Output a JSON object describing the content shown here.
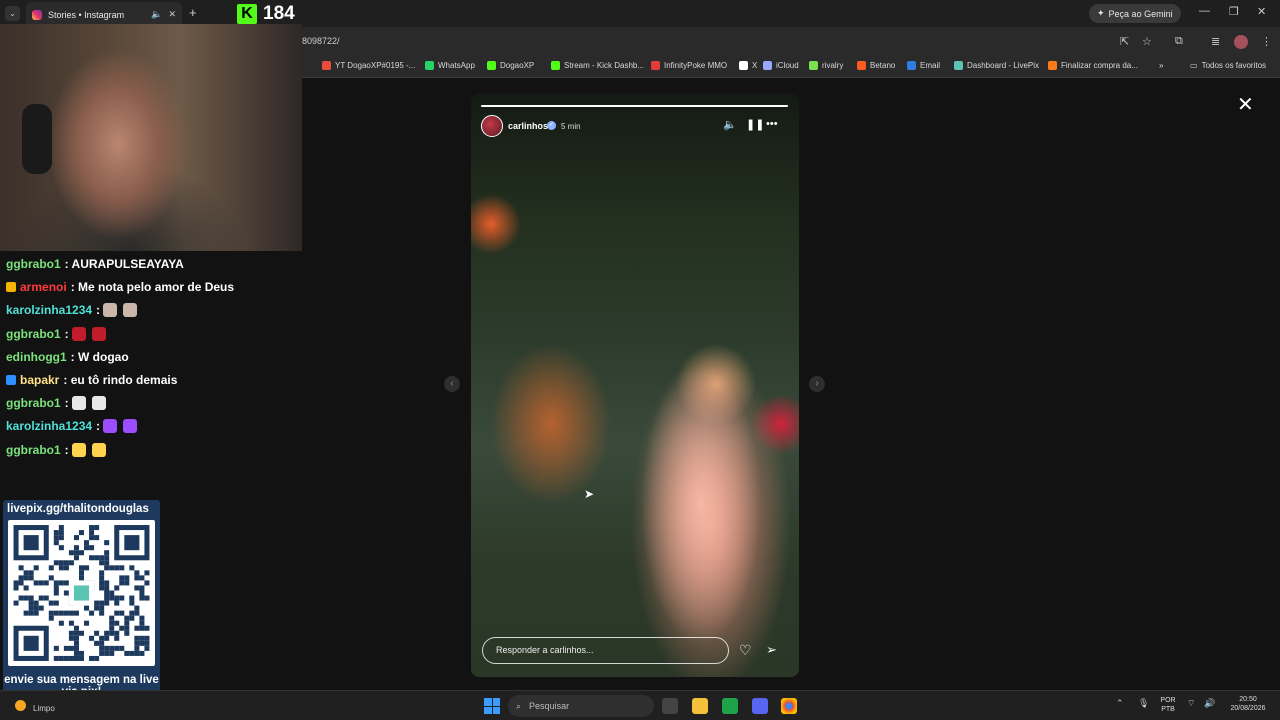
{
  "browser": {
    "tab_title": "Stories • Instagram",
    "gemini_label": "Peça ao Gemini",
    "url": "8098722/",
    "bookmarks": [
      {
        "label": "YT DogaoXP#0195 -...",
        "color": "#e74c3c"
      },
      {
        "label": "WhatsApp",
        "color": "#25d366"
      },
      {
        "label": "DogaoXP",
        "color": "#53fc18"
      },
      {
        "label": "Stream - Kick Dashb...",
        "color": "#53fc18"
      },
      {
        "label": "InfinityPoke MMO",
        "color": "#e23b3b"
      },
      {
        "label": "X",
        "color": "#ffffff"
      },
      {
        "label": "iCloud",
        "color": "#9aa7ff"
      },
      {
        "label": "rivalry",
        "color": "#7be04f"
      },
      {
        "label": "Betano",
        "color": "#ff5a1f"
      },
      {
        "label": "Email",
        "color": "#2f7de1"
      },
      {
        "label": "Dashboard - LivePix",
        "color": "#5bc4b2"
      },
      {
        "label": "Finalizar compra da...",
        "color": "#ff7a1a"
      }
    ],
    "all_bookmarks": "Todos os favoritos"
  },
  "story": {
    "username": "carlinhos",
    "time": "5 min",
    "progress": 1.0,
    "reply_placeholder": "Responder a carlinhos..."
  },
  "stream": {
    "viewer_count": "184",
    "chat": [
      {
        "user": "ggbrabo1",
        "user_color": "#7ce37c",
        "text": ": AURAPULSEAYAYA",
        "badge": null,
        "emotes": []
      },
      {
        "user": "armenoi",
        "user_color": "#ff3b3b",
        "text": ": Me nota pelo amor de Deus",
        "badge": "#f5b400",
        "emotes": []
      },
      {
        "user": "karolzinha1234",
        "user_color": "#4fe0d8",
        "text": ":",
        "badge": null,
        "emotes": [
          "#c9b6a8",
          "#c9b6a8"
        ]
      },
      {
        "user": "ggbrabo1",
        "user_color": "#7ce37c",
        "text": ":",
        "badge": null,
        "emotes": [
          "#c01c2c",
          "#c01c2c"
        ]
      },
      {
        "user": "edinhogg1",
        "user_color": "#7ce37c",
        "text": ": W dogao",
        "badge": null,
        "emotes": []
      },
      {
        "user": "bapakr",
        "user_color": "#ffe08a",
        "text": ": eu tô rindo demais",
        "badge": "#2e8fff",
        "emotes": []
      },
      {
        "user": "ggbrabo1",
        "user_color": "#7ce37c",
        "text": ":",
        "badge": null,
        "emotes": [
          "#e8e8e8",
          "#e8e8e8"
        ]
      },
      {
        "user": "karolzinha1234",
        "user_color": "#4fe0d8",
        "text": ":",
        "badge": null,
        "emotes": [
          "#9b4dff",
          "#9b4dff"
        ]
      },
      {
        "user": "ggbrabo1",
        "user_color": "#7ce37c",
        "text": ":",
        "badge": null,
        "emotes": [
          "#ffd34d",
          "#ffd34d"
        ]
      }
    ],
    "pix_url": "livepix.gg/thalitondouglas",
    "pix_cta": "envie sua mensagem na live via pix!"
  },
  "taskbar": {
    "weather": "Limpo",
    "search_placeholder": "Pesquisar",
    "lang": "POR\nPTB",
    "time": "20:50",
    "date": "20/08/2026"
  }
}
